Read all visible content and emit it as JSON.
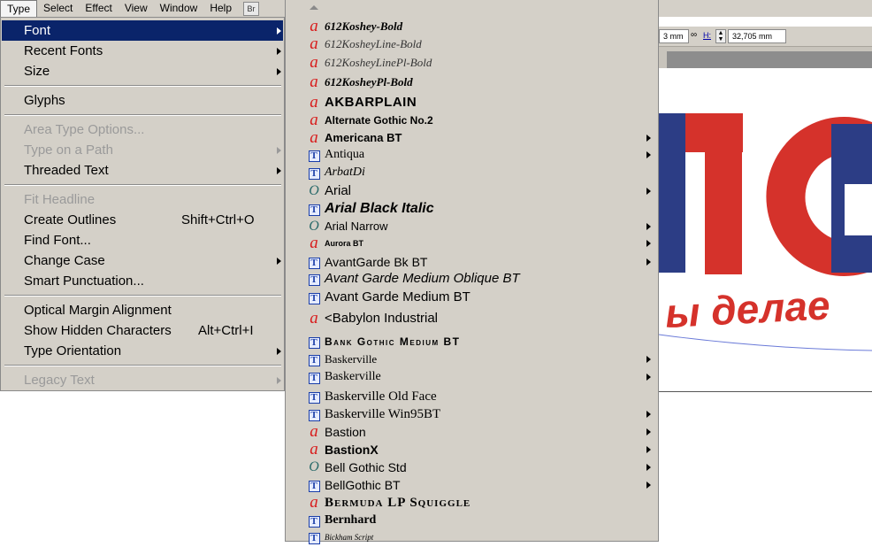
{
  "menubar": {
    "items": [
      "Type",
      "Select",
      "Effect",
      "View",
      "Window",
      "Help"
    ],
    "bridge_label": "Br"
  },
  "control_bar": {
    "w_value": "3 mm",
    "h_label": "H:",
    "h_value": "32,705 mm"
  },
  "type_menu": {
    "items": [
      {
        "label": "Font",
        "shortcut": "",
        "submenu": true,
        "state": "highlighted"
      },
      {
        "label": "Recent Fonts",
        "shortcut": "",
        "submenu": true,
        "state": "enabled"
      },
      {
        "label": "Size",
        "shortcut": "",
        "submenu": true,
        "state": "enabled"
      },
      {
        "label": "Glyphs",
        "shortcut": "",
        "submenu": false,
        "state": "enabled"
      },
      {
        "label": "Area Type Options...",
        "shortcut": "",
        "submenu": false,
        "state": "disabled"
      },
      {
        "label": "Type on a Path",
        "shortcut": "",
        "submenu": true,
        "state": "disabled"
      },
      {
        "label": "Threaded Text",
        "shortcut": "",
        "submenu": true,
        "state": "enabled"
      },
      {
        "label": "Fit Headline",
        "shortcut": "",
        "submenu": false,
        "state": "disabled"
      },
      {
        "label": "Create Outlines",
        "shortcut": "Shift+Ctrl+O",
        "submenu": false,
        "state": "enabled"
      },
      {
        "label": "Find Font...",
        "shortcut": "",
        "submenu": false,
        "state": "enabled"
      },
      {
        "label": "Change Case",
        "shortcut": "",
        "submenu": true,
        "state": "enabled"
      },
      {
        "label": "Smart Punctuation...",
        "shortcut": "",
        "submenu": false,
        "state": "enabled"
      },
      {
        "label": "Optical Margin Alignment",
        "shortcut": "",
        "submenu": false,
        "state": "enabled"
      },
      {
        "label": "Show Hidden Characters",
        "shortcut": "Alt+Ctrl+I",
        "submenu": false,
        "state": "enabled"
      },
      {
        "label": "Type Orientation",
        "shortcut": "",
        "submenu": true,
        "state": "enabled"
      },
      {
        "label": "Legacy Text",
        "shortcut": "",
        "submenu": true,
        "state": "disabled"
      }
    ]
  },
  "font_menu": {
    "items": [
      {
        "name": "612Koshey-Bold",
        "icon": "a",
        "submenu": false
      },
      {
        "name": "612KosheyLine-Bold",
        "icon": "a",
        "submenu": false
      },
      {
        "name": "612KosheyLinePl-Bold",
        "icon": "a",
        "submenu": false
      },
      {
        "name": "612KosheyPl-Bold",
        "icon": "a",
        "submenu": false
      },
      {
        "name": "AKBARPLAIN",
        "icon": "a",
        "submenu": false
      },
      {
        "name": "Alternate Gothic No.2",
        "icon": "a",
        "submenu": false
      },
      {
        "name": "Americana BT",
        "icon": "a",
        "submenu": true
      },
      {
        "name": "Antiqua",
        "icon": "t",
        "submenu": true
      },
      {
        "name": "ArbatDi",
        "icon": "t",
        "submenu": false
      },
      {
        "name": "Arial",
        "icon": "o",
        "submenu": true
      },
      {
        "name": "Arial Black Italic",
        "icon": "t",
        "submenu": false
      },
      {
        "name": "Arial Narrow",
        "icon": "o",
        "submenu": true
      },
      {
        "name": "Aurora BT",
        "icon": "a",
        "submenu": true
      },
      {
        "name": "AvantGarde Bk BT",
        "icon": "t",
        "submenu": true
      },
      {
        "name": "Avant Garde Medium Oblique BT",
        "icon": "t",
        "submenu": false
      },
      {
        "name": "Avant Garde Medium BT",
        "icon": "t",
        "submenu": false
      },
      {
        "name": "<Babylon Industrial",
        "icon": "a",
        "submenu": false
      },
      {
        "name": "Bank Gothic Medium BT",
        "icon": "t",
        "submenu": false
      },
      {
        "name": "Baskerville",
        "icon": "t",
        "submenu": true
      },
      {
        "name": "Baskerville",
        "icon": "t",
        "submenu": true
      },
      {
        "name": "Baskerville Old Face",
        "icon": "t",
        "submenu": false
      },
      {
        "name": "Baskerville Win95BT",
        "icon": "t",
        "submenu": true
      },
      {
        "name": "Bastion",
        "icon": "a",
        "submenu": true
      },
      {
        "name": "BastionX",
        "icon": "a",
        "submenu": true
      },
      {
        "name": "Bell Gothic Std",
        "icon": "o",
        "submenu": true
      },
      {
        "name": "BellGothic BT",
        "icon": "t",
        "submenu": true
      },
      {
        "name": "Bermuda LP Squiggle",
        "icon": "a",
        "submenu": false
      },
      {
        "name": "Bernhard",
        "icon": "t",
        "submenu": false
      },
      {
        "name": "Bickham Script",
        "icon": "t",
        "submenu": false
      }
    ]
  },
  "artwork": {
    "text": "ы делае",
    "red": "#d5322b",
    "blue": "#2c3d85"
  }
}
